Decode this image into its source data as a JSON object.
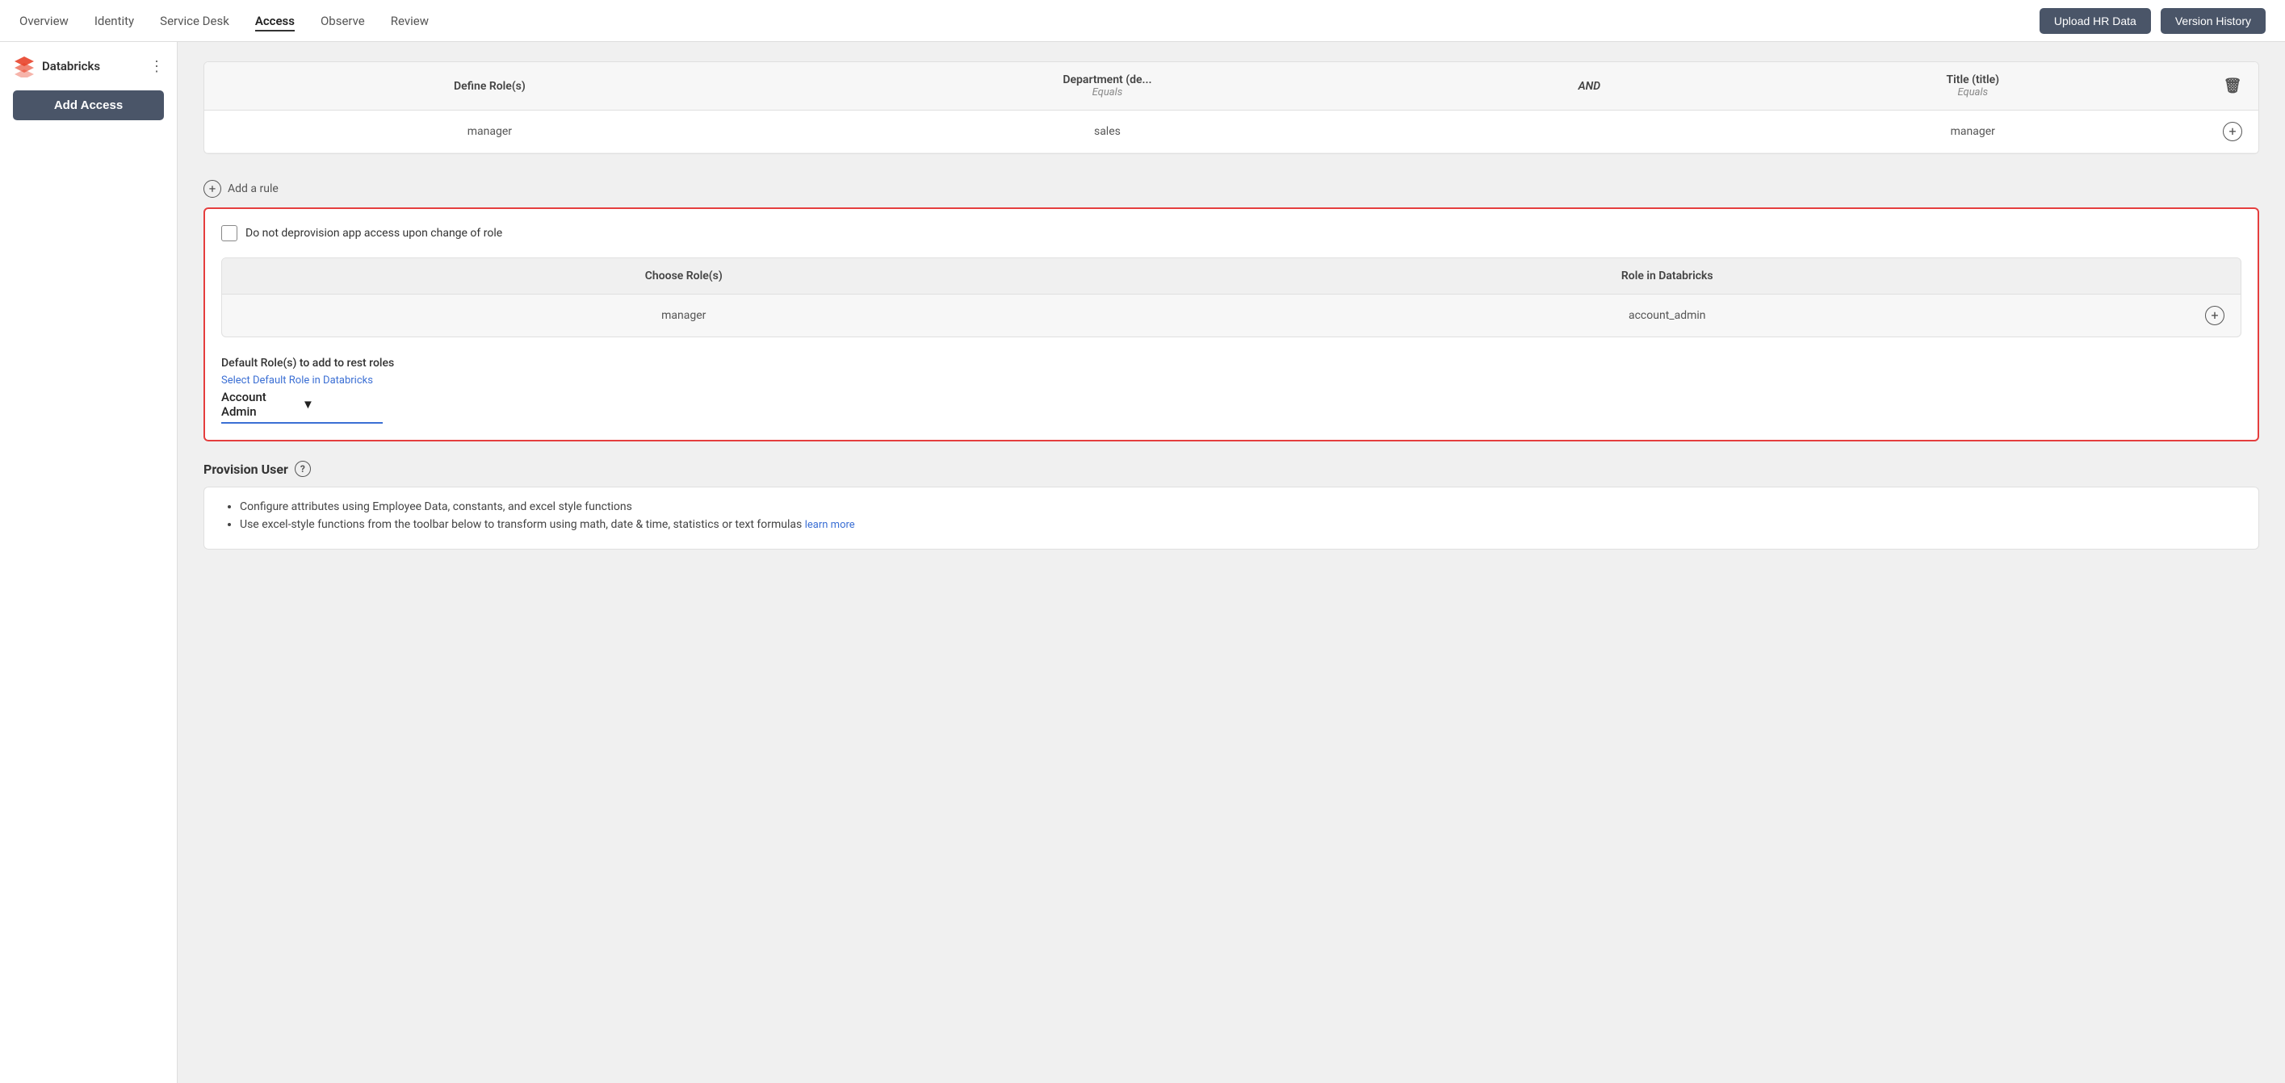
{
  "nav": {
    "links": [
      {
        "label": "Overview",
        "active": false
      },
      {
        "label": "Identity",
        "active": false
      },
      {
        "label": "Service Desk",
        "active": false
      },
      {
        "label": "Access",
        "active": true
      },
      {
        "label": "Observe",
        "active": false
      },
      {
        "label": "Review",
        "active": false
      }
    ],
    "upload_hr_data": "Upload HR Data",
    "version_history": "Version History"
  },
  "sidebar": {
    "brand": "Databricks",
    "add_access": "Add Access"
  },
  "top_table": {
    "headers": [
      {
        "label": "Define Role(s)",
        "sub": ""
      },
      {
        "label": "Department (de...",
        "sub": "Equals"
      },
      {
        "label": "AND",
        "sub": "",
        "is_and": true
      },
      {
        "label": "Title (title)",
        "sub": "Equals"
      }
    ],
    "row": {
      "define_role": "manager",
      "department": "sales",
      "title": "manager"
    }
  },
  "add_rule": "Add a rule",
  "checkbox_label": "Do not deprovision app access upon change of role",
  "inner_table": {
    "headers": [
      "Choose Role(s)",
      "Role in Databricks"
    ],
    "row": {
      "choose_role": "manager",
      "role_in_databricks": "account_admin"
    }
  },
  "default_roles": {
    "label": "Default Role(s) to add to rest roles",
    "select_label": "Select Default Role in Databricks",
    "selected_value": "Account Admin"
  },
  "provision": {
    "header": "Provision User",
    "bullets": [
      "Configure attributes using Employee Data, constants, and excel style functions",
      "Use excel-style functions from the toolbar below to transform using math, date & time, statistics or text formulas"
    ],
    "learn_more": "learn more"
  }
}
